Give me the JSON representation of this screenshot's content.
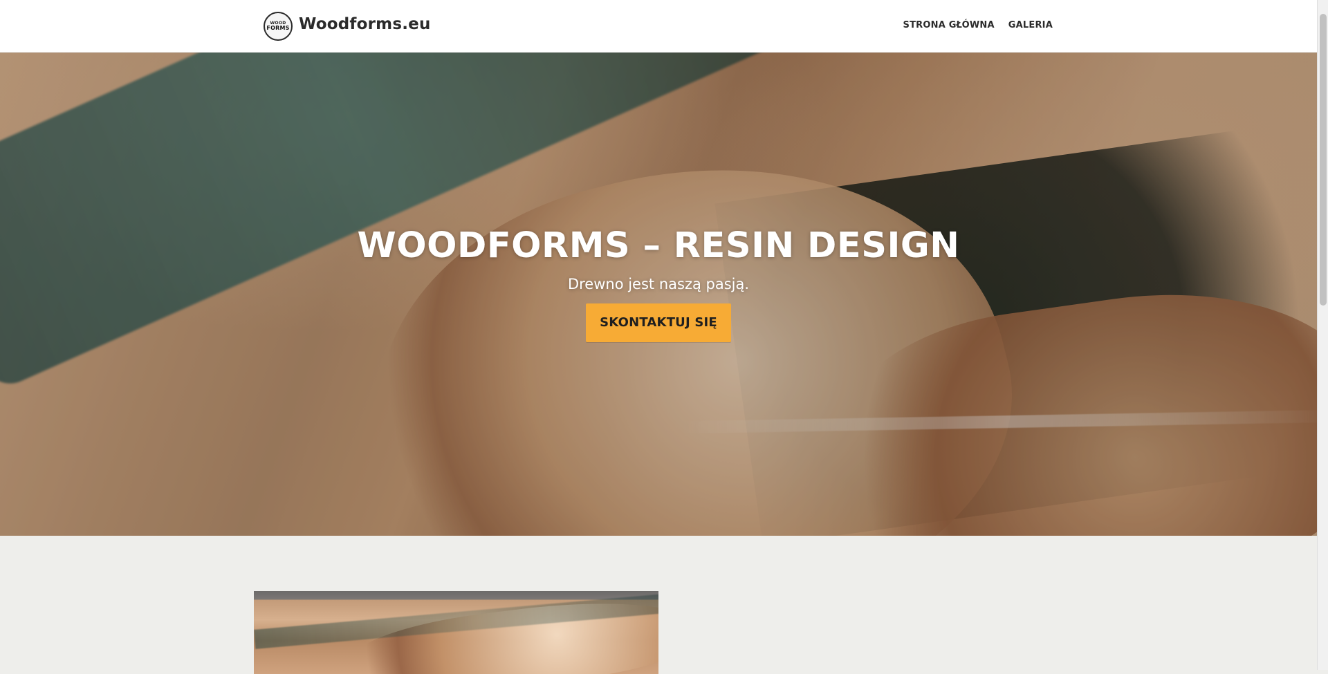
{
  "header": {
    "brand": "Woodforms.eu",
    "logo_top": "WOOD",
    "logo_bottom": "FORMS",
    "nav": [
      {
        "label": "STRONA GŁÓWNA"
      },
      {
        "label": "GALERIA"
      }
    ]
  },
  "hero": {
    "title": "WOODFORMS – RESIN DESIGN",
    "subtitle": "Drewno jest naszą pasją.",
    "cta_label": "SKONTAKTUJ SIĘ"
  },
  "colors": {
    "accent": "#f7ab35",
    "header_bg": "#ffffff",
    "section_bg": "#eeeeeb"
  }
}
